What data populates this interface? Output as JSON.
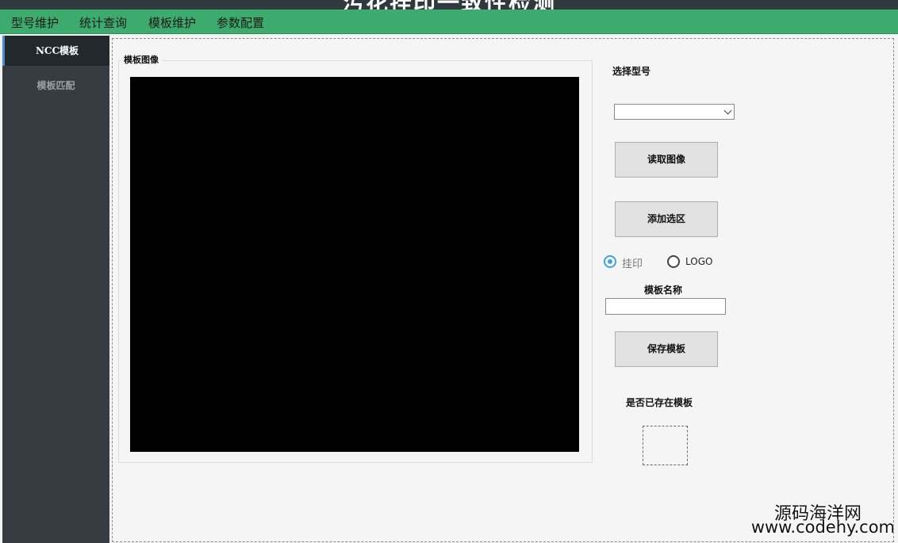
{
  "app": {
    "title": "污花挂印一致性检测"
  },
  "menu": {
    "items": [
      {
        "label": "型号维护"
      },
      {
        "label": "统计查询"
      },
      {
        "label": "模板维护"
      },
      {
        "label": "参数配置"
      }
    ]
  },
  "sidebar": {
    "items": [
      {
        "label": "NCC模板",
        "active": true
      },
      {
        "label": "模板匹配",
        "active": false
      }
    ]
  },
  "main": {
    "image_group_title": "模板图像",
    "select_model_label": "选择型号",
    "model_select_value": "",
    "read_image_button": "读取图像",
    "add_region_button": "添加选区",
    "radio_options": [
      {
        "label": "挂印",
        "checked": true
      },
      {
        "label": "LOGO",
        "checked": false
      }
    ],
    "template_name_label": "模板名称",
    "template_name_value": "",
    "save_template_button": "保存模板",
    "exists_label": "是否已存在模板"
  },
  "watermark": {
    "line1": "源码海洋网",
    "line2": "www.codehy.com"
  },
  "colors": {
    "menubar": "#3dab6d",
    "sidebar": "#363c42",
    "sidebar_active": "#23282c",
    "radio_accent": "#3ba3e0",
    "canvas": "#000000"
  }
}
